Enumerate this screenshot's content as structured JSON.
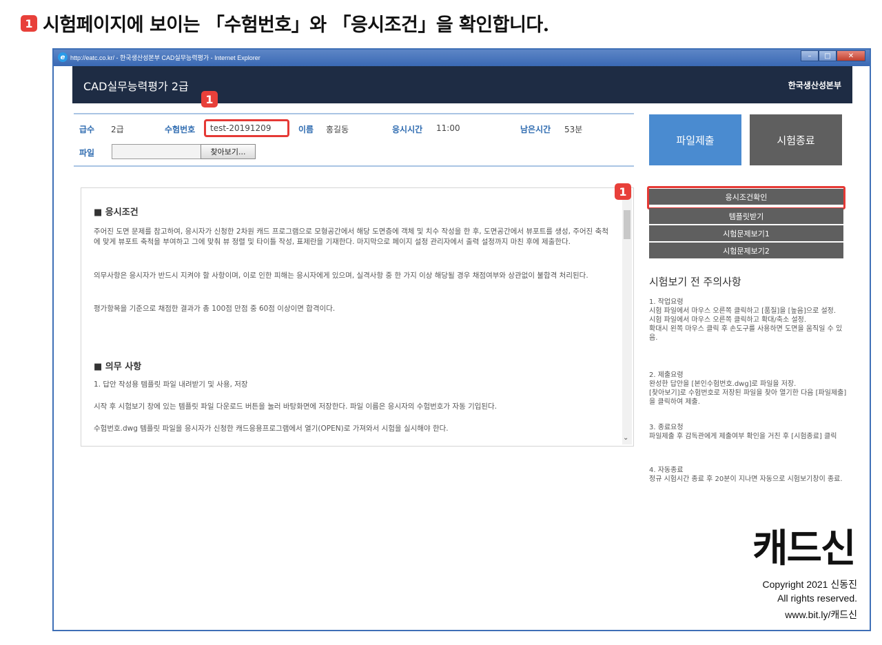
{
  "step_badge": "1",
  "heading": "시험페이지에 보이는 「수험번호」와 「응시조건」을 확인합니다.",
  "window": {
    "title": "http://eatc.co.kr/ - 한국생산성본부 CAD실무능력평가 - Internet Explorer",
    "ie_icon": "e",
    "minimize_icon": "minimize-icon",
    "maximize_icon": "maximize-icon",
    "close_icon": "close-icon"
  },
  "app": {
    "title": "CAD실무능력평가 2급",
    "org": "한국생산성본부"
  },
  "info": {
    "grade_label": "급수",
    "grade_value": "2급",
    "exam_no_label": "수험번호",
    "exam_no_value": "test-20191209",
    "name_label": "이름",
    "name_value": "홍길동",
    "start_time_label": "응시시간",
    "start_time_value": "11:00",
    "remaining_label": "남은시간",
    "remaining_value": "53분",
    "file_label": "파일",
    "file_value": "",
    "browse_label": "찾아보기..."
  },
  "conditions": {
    "section1_title": "■ 응시조건",
    "para1": "주어진 도면 문제를 참고하여, 응시자가 신청한 2차원 캐드 프로그램으로 모형공간에서 해당 도면층에 객체 및 치수 작성을 한 후, 도면공간에서 뷰포트를 생성, 주어진 축척에 맞게 뷰포트 축척을 부여하고 그에 맞춰 뷰 정렬 및 타이틀 작성, 표제란을 기재한다. 마지막으로 페이지 설정 관리자에서 출력 설정까지 마친 후에 제출한다.",
    "para2": "의무사항은 응시자가 반드시 지켜야 할 사항이며, 이로 인한 피해는 응시자에게 있으며, 실격사항 중 한 가지 이상 해당될 경우 채점여부와 상관없이 불합격 처리된다.",
    "para3": "평가항목을 기준으로 채점한 결과가 총 100점 만점 중 60점 이상이면 합격이다.",
    "section2_title": "■ 의무 사항",
    "para4": "1. 답안 작성용 템플릿 파일 내려받기 및 사용, 저장",
    "para5": "시작 후 시험보기 창에 있는 템플릿 파일 다운로드 버튼을 눌러 바탕화면에 저장한다. 파일 이름은 응시자의 수험번호가 자동 기입된다.",
    "para6": "수험번호.dwg 템플릿 파일을 응시자가 신청한 캐드응용프로그램에서 열기(OPEN)로 가져와서 시험을 실시해야 한다.",
    "scroll_down_icon": "chevron-down-icon"
  },
  "buttons": {
    "submit": "파일제출",
    "end": "시험종료",
    "check_conditions": "응시조건확인",
    "template": "템플릿받기",
    "view_q1": "시험문제보기1",
    "view_q2": "시험문제보기2"
  },
  "notes": {
    "title": "시험보기 전 주의사항",
    "n1": "1. 작업요령\n시험 파일에서 마우스 오른쪽 클릭하고 [품질]을 [높음]으로 설정.\n시험 파일에서 마우스 오른쪽 클릭하고 확대/축소 설정.\n확대시 왼쪽 마우스 클릭 후 손도구를 사용하면 도면을 움직일 수 있음.",
    "n2": "2. 제출요령\n완성한 답안을 [본인수험번호.dwg]로 파일을 저장.\n[찾아보기]로 수험번호로 저장된 파일을 찾아 열기한 다음 [파일제출]을 클릭하여 제출.",
    "n3": "3. 종료요청\n파일제출 후 감독관에게 제출여부 확인을 거친 후 [시험종료] 클릭",
    "n4": "4. 자동종료\n정규 시험시간 종료 후 20분이 지나면 자동으로 시험보기창이 종료."
  },
  "branding": {
    "logo": "캐드신",
    "copyright1": "Copyright 2021 신동진",
    "copyright2": "All rights reserved.",
    "copyright3": "www.bit.ly/캐드신"
  },
  "colors": {
    "badge": "#e8403a",
    "header_bg": "#1e2c44",
    "submit_bg": "#4a8bd0",
    "grey_btn": "#5f5f5f",
    "label_blue": "#2e6bb0"
  }
}
